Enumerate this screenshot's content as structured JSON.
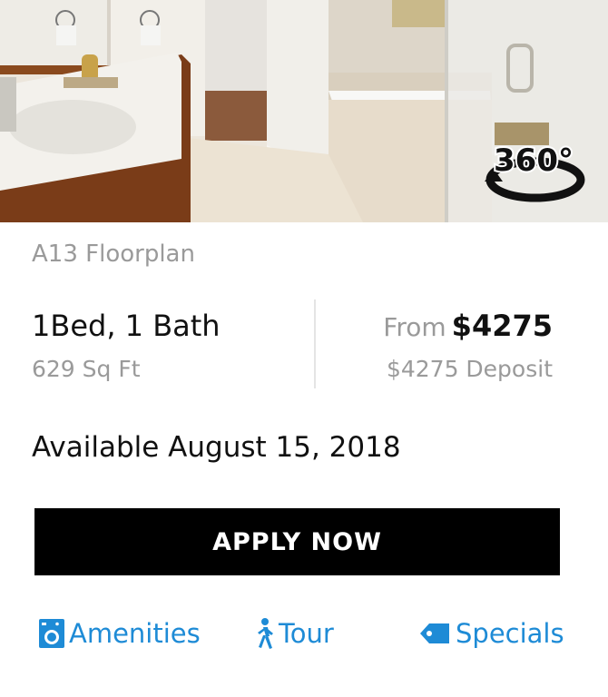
{
  "card": {
    "floorplan_name": "A13 Floorplan",
    "beds_baths": "1Bed, 1 Bath",
    "sqft": "629 Sq Ft",
    "price_prefix": "From",
    "price": "$4275",
    "deposit": "$4275 Deposit",
    "availability": "Available August 15, 2018",
    "badge_360": "360°",
    "apply_label": "APPLY NOW"
  },
  "links": {
    "amenities": "Amenities",
    "tour": "Tour",
    "specials": "Specials"
  },
  "colors": {
    "link_blue": "#1e8bd6",
    "button_black": "#000000",
    "muted_text": "#9a9a9a"
  },
  "icons": {
    "amenities": "washer-icon",
    "tour": "walking-person-icon",
    "specials": "tag-icon",
    "panorama": "360-view-icon"
  }
}
